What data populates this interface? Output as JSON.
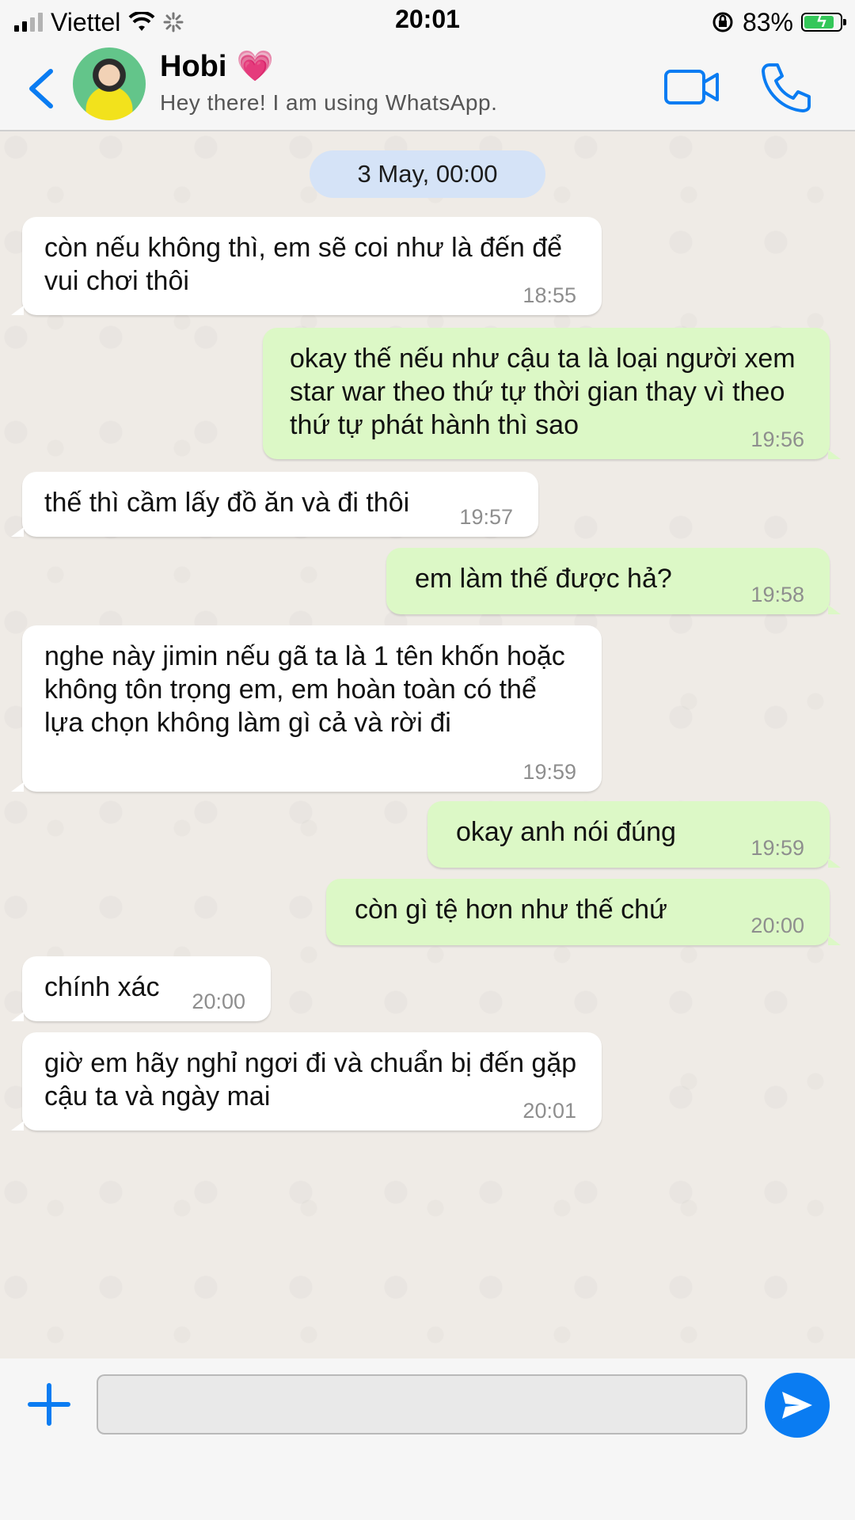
{
  "status_bar": {
    "carrier": "Viettel",
    "time": "20:01",
    "battery_percent": "83%",
    "battery_level": 0.83
  },
  "header": {
    "contact_name": "Hobi",
    "contact_emoji": "💗",
    "contact_status": "Hey there! I am using WhatsApp.",
    "icons": [
      "back-chevron-icon",
      "video-call-icon",
      "phone-icon"
    ]
  },
  "chat": {
    "date_label": "3 May, 00:00",
    "messages": [
      {
        "direction": "in",
        "text": "còn nếu không thì, em sẽ coi như là đến để vui chơi thôi",
        "time": "18:55"
      },
      {
        "direction": "out",
        "text": "okay thế nếu như cậu ta là loại người xem star war theo thứ tự thời gian thay vì theo thứ tự phát hành thì sao",
        "time": "19:56"
      },
      {
        "direction": "in",
        "text": "thế thì cầm lấy đồ ăn và đi thôi",
        "time": "19:57"
      },
      {
        "direction": "out",
        "text": "em làm thế được hả?",
        "time": "19:58"
      },
      {
        "direction": "in",
        "text": "nghe này jimin nếu gã ta là 1 tên khốn hoặc không tôn trọng em, em hoàn toàn có thể lựa chọn không làm gì cả và rời đi",
        "time": "19:59"
      },
      {
        "direction": "out",
        "text": "okay anh nói đúng",
        "time": "19:59"
      },
      {
        "direction": "out",
        "text": "còn gì tệ hơn như thế chứ",
        "time": "20:00"
      },
      {
        "direction": "in",
        "text": "chính xác",
        "time": "20:00"
      },
      {
        "direction": "in",
        "text": "giờ em hãy nghỉ ngơi đi và chuẩn bị đến gặp cậu ta và ngày mai",
        "time": "20:01"
      }
    ]
  },
  "input_bar": {
    "message_value": "",
    "icons": [
      "plus-icon",
      "send-icon"
    ]
  },
  "colors": {
    "accent": "#0a7cf2",
    "outgoing_bubble": "#dcf8c6",
    "incoming_bubble": "#ffffff",
    "date_pill": "#d5e3f7",
    "chat_background": "#efebe6"
  }
}
